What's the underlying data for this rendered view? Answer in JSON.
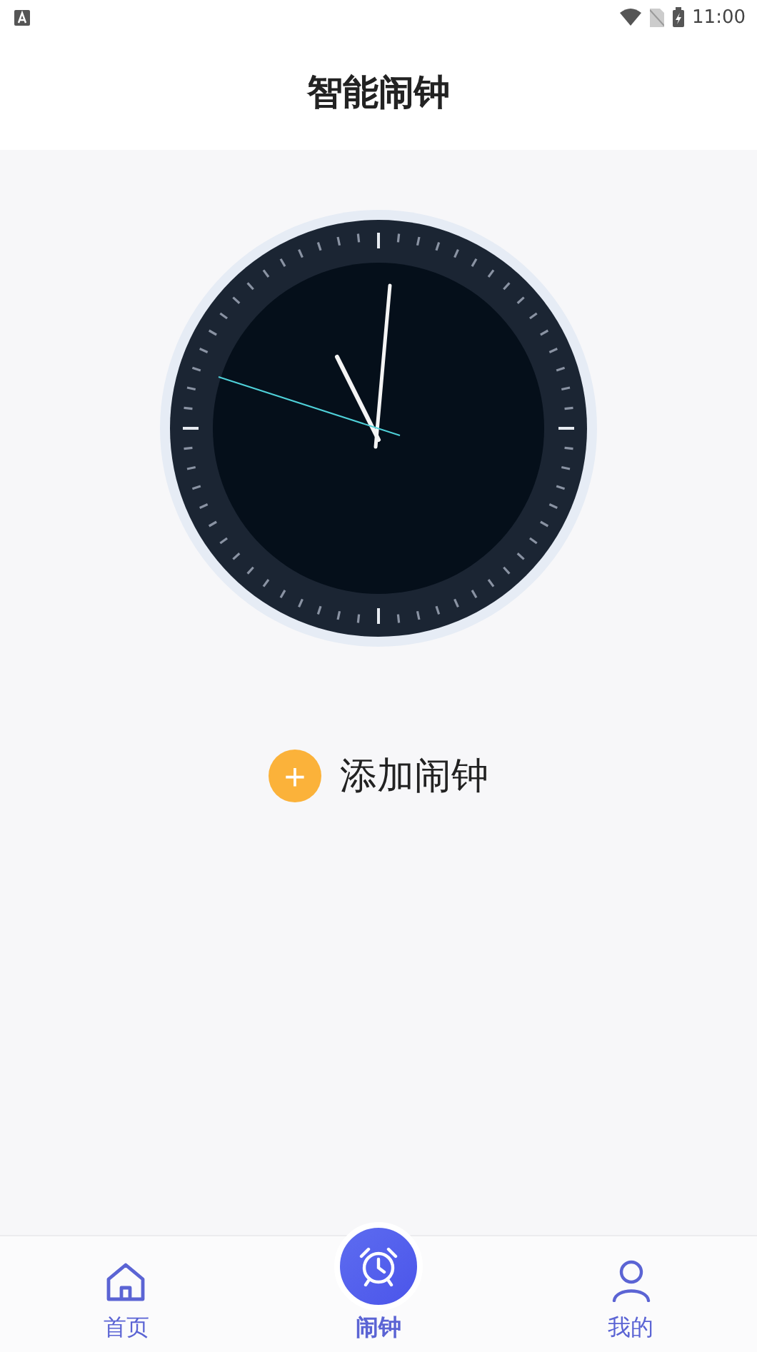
{
  "status_bar": {
    "time": "11:00"
  },
  "header": {
    "title": "智能闹钟"
  },
  "add_alarm": {
    "icon": "+",
    "label": "添加闹钟"
  },
  "nav_tabs": [
    {
      "kind": "home",
      "label": "首页",
      "selected": false
    },
    {
      "kind": "alarm",
      "label": "闹钟",
      "selected": true
    },
    {
      "kind": "profile",
      "label": "我的",
      "selected": false
    }
  ]
}
